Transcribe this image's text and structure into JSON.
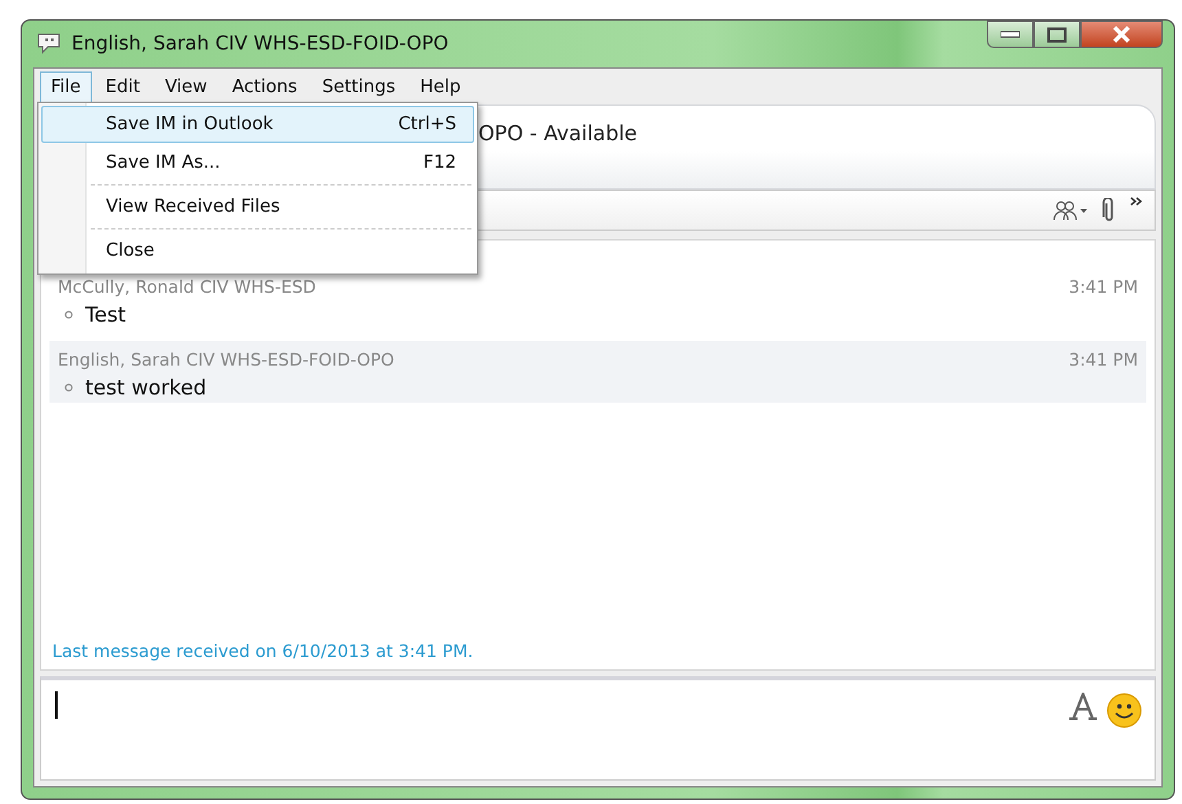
{
  "window": {
    "title": "English, Sarah CIV WHS-ESD-FOID-OPO"
  },
  "menu_bar": [
    {
      "label": "File",
      "selected": true
    },
    {
      "label": "Edit",
      "selected": false
    },
    {
      "label": "View",
      "selected": false
    },
    {
      "label": "Actions",
      "selected": false
    },
    {
      "label": "Settings",
      "selected": false
    },
    {
      "label": "Help",
      "selected": false
    }
  ],
  "file_menu": [
    {
      "label": "Save IM in Outlook",
      "shortcut": "Ctrl+S",
      "selected": true
    },
    {
      "label": "Save IM As...",
      "shortcut": "F12",
      "selected": false
    },
    {
      "label": "View Received Files",
      "selected": false
    },
    {
      "label": "Close",
      "selected": false
    }
  ],
  "contact_header": {
    "status_text": "OPO  - Available"
  },
  "messages": [
    {
      "sender": "McCully, Ronald CIV WHS-ESD",
      "time": "3:41 PM",
      "text": "Test",
      "highlighted": false
    },
    {
      "sender": "English, Sarah CIV WHS-ESD-FOID-OPO",
      "time": "3:41 PM",
      "text": "test worked",
      "highlighted": true
    }
  ],
  "status_line": "Last message received on 6/10/2013 at 3:41 PM."
}
